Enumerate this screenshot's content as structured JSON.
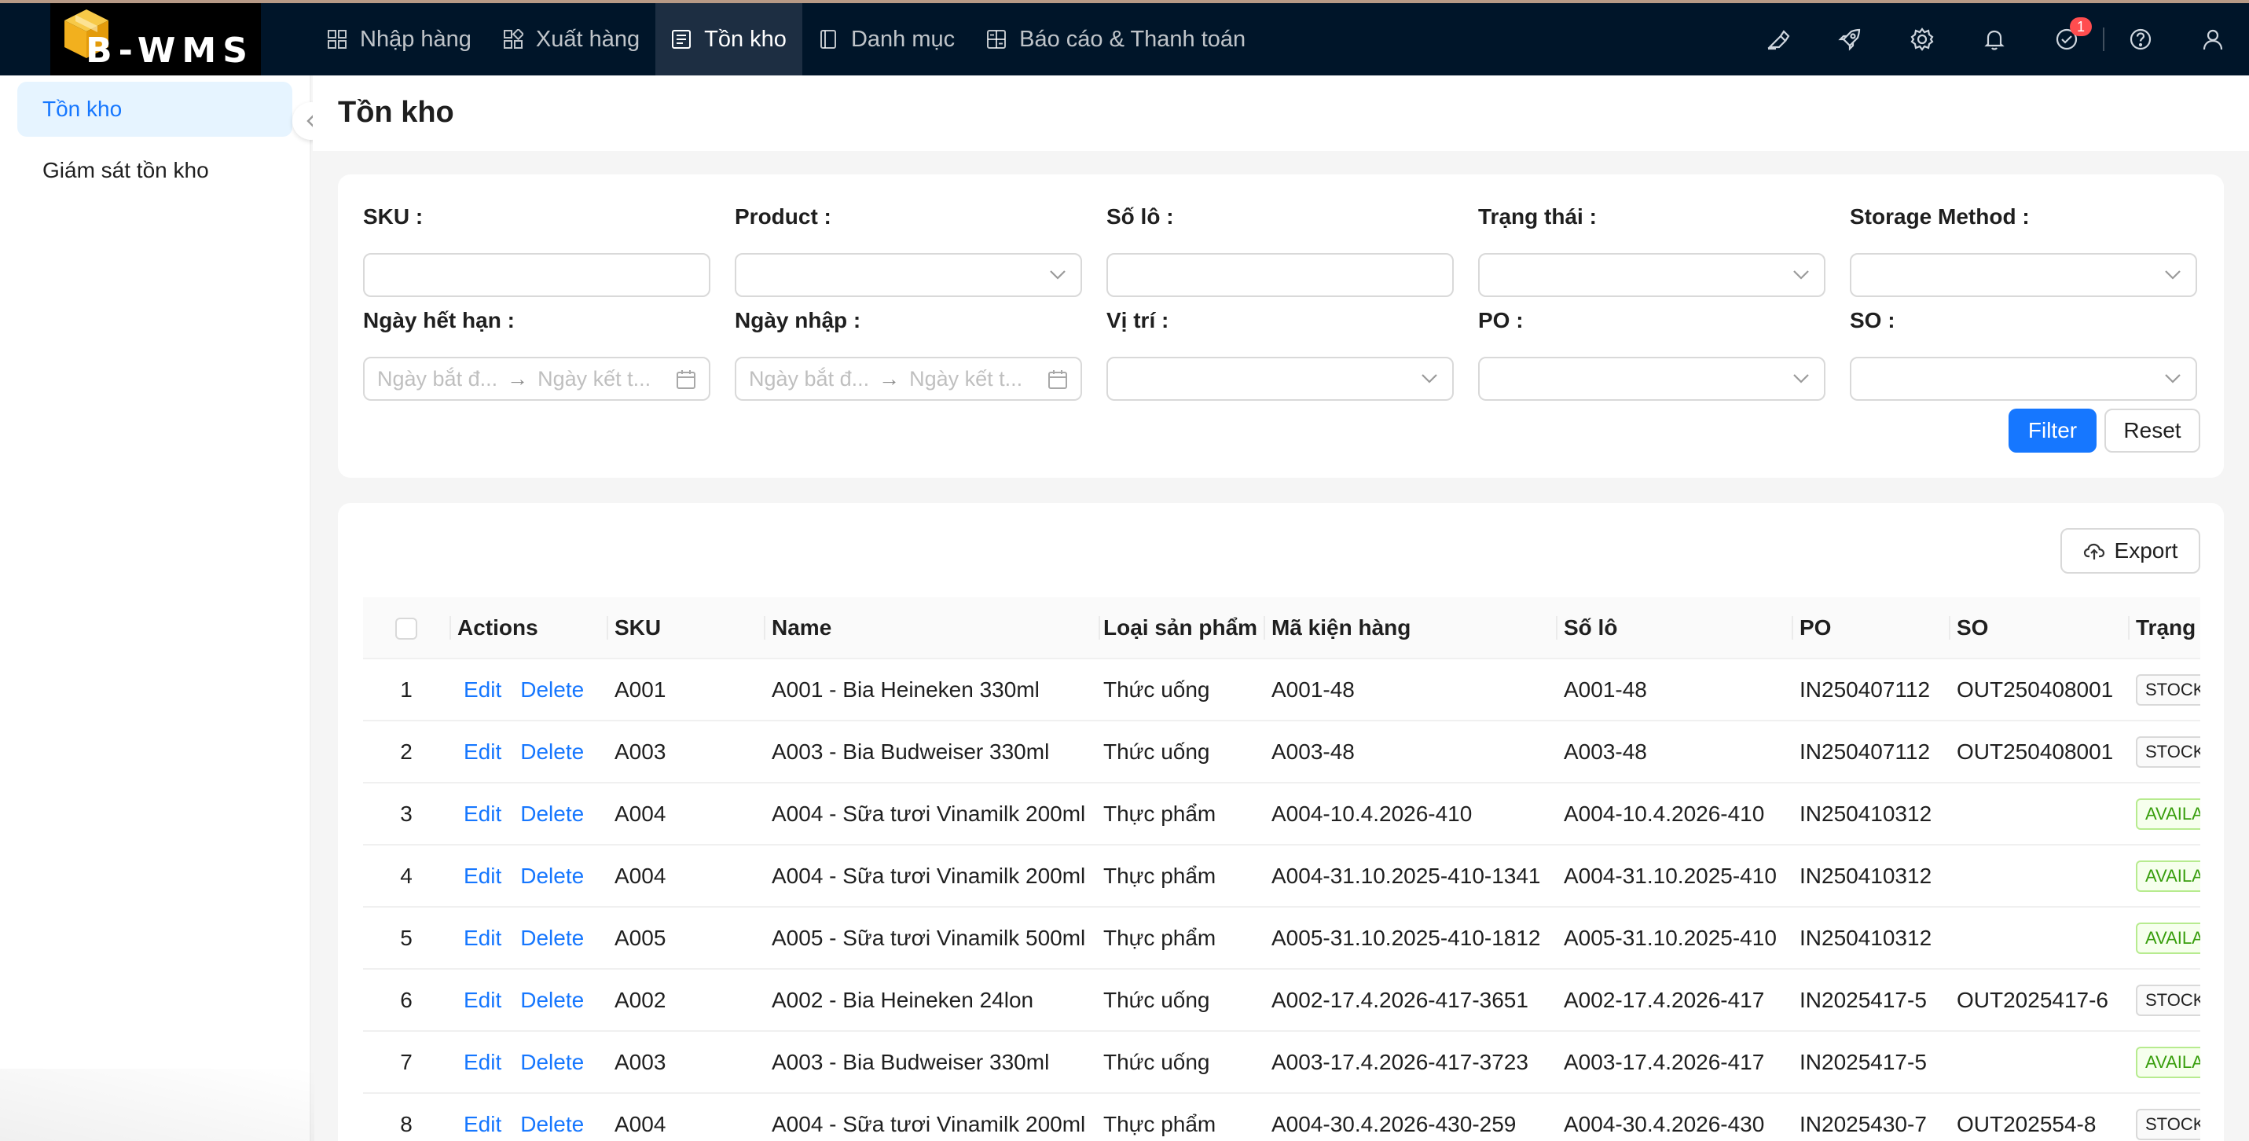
{
  "app": {
    "logo_text": "B-WMS",
    "nav": [
      {
        "label": "Nhập hàng",
        "icon": "grid-icon"
      },
      {
        "label": "Xuất hàng",
        "icon": "apps-icon"
      },
      {
        "label": "Tồn kho",
        "icon": "list-icon",
        "active": true
      },
      {
        "label": "Danh mục",
        "icon": "book-icon"
      },
      {
        "label": "Báo cáo & Thanh toán",
        "icon": "calculator-icon"
      }
    ],
    "notification_badge": "1",
    "accent_color": "#1677ff",
    "header_bg": "#001529"
  },
  "sidebar": {
    "items": [
      {
        "label": "Tồn kho",
        "active": true
      },
      {
        "label": "Giám sát tồn kho"
      }
    ]
  },
  "page": {
    "title": "Tồn kho"
  },
  "filters": {
    "sku_label": "SKU :",
    "product_label": "Product :",
    "lot_label": "Số lô :",
    "status_label": "Trạng thái :",
    "storage_label": "Storage Method :",
    "expiry_label": "Ngày hết hạn :",
    "import_label": "Ngày nhập :",
    "location_label": "Vị trí :",
    "po_label": "PO :",
    "so_label": "SO :",
    "range_start_placeholder": "Ngày bắt đ...",
    "range_end_placeholder": "Ngày kết t...",
    "filter_button": "Filter",
    "reset_button": "Reset"
  },
  "table": {
    "export_button": "Export",
    "columns": [
      "Actions",
      "SKU",
      "Name",
      "Loại sản phẩm",
      "Mã kiện hàng",
      "Số lô",
      "PO",
      "SO",
      "Trạng"
    ],
    "edit_label": "Edit",
    "delete_label": "Delete",
    "rows": [
      {
        "no": "1",
        "sku": "A001",
        "name": "A001 - Bia Heineken 330ml",
        "type": "Thức uống",
        "package": "A001-48",
        "lot": "A001-48",
        "po": "IN250407112",
        "so": "OUT250408001",
        "status": "STOCK",
        "status_kind": "stock"
      },
      {
        "no": "2",
        "sku": "A003",
        "name": "A003 - Bia Budweiser 330ml",
        "type": "Thức uống",
        "package": "A003-48",
        "lot": "A003-48",
        "po": "IN250407112",
        "so": "OUT250408001",
        "status": "STOCK",
        "status_kind": "stock"
      },
      {
        "no": "3",
        "sku": "A004",
        "name": "A004 - Sữa tươi Vinamilk 200ml",
        "type": "Thực phẩm",
        "package": "A004-10.4.2026-410",
        "lot": "A004-10.4.2026-410",
        "po": "IN250410312",
        "so": "",
        "status": "AVAILABLE",
        "status_kind": "available"
      },
      {
        "no": "4",
        "sku": "A004",
        "name": "A004 - Sữa tươi Vinamilk 200ml",
        "type": "Thực phẩm",
        "package": "A004-31.10.2025-410-1341",
        "lot": "A004-31.10.2025-410",
        "po": "IN250410312",
        "so": "",
        "status": "AVAILABLE",
        "status_kind": "available"
      },
      {
        "no": "5",
        "sku": "A005",
        "name": "A005 - Sữa tươi Vinamilk 500ml",
        "type": "Thực phẩm",
        "package": "A005-31.10.2025-410-1812",
        "lot": "A005-31.10.2025-410",
        "po": "IN250410312",
        "so": "",
        "status": "AVAILABLE",
        "status_kind": "available"
      },
      {
        "no": "6",
        "sku": "A002",
        "name": "A002 - Bia Heineken 24lon",
        "type": "Thức uống",
        "package": "A002-17.4.2026-417-3651",
        "lot": "A002-17.4.2026-417",
        "po": "IN2025417-5",
        "so": "OUT2025417-6",
        "status": "STOCK",
        "status_kind": "stock"
      },
      {
        "no": "7",
        "sku": "A003",
        "name": "A003 - Bia Budweiser 330ml",
        "type": "Thức uống",
        "package": "A003-17.4.2026-417-3723",
        "lot": "A003-17.4.2026-417",
        "po": "IN2025417-5",
        "so": "",
        "status": "AVAILABLE",
        "status_kind": "available"
      },
      {
        "no": "8",
        "sku": "A004",
        "name": "A004 - Sữa tươi Vinamilk 200ml",
        "type": "Thực phẩm",
        "package": "A004-30.4.2026-430-259",
        "lot": "A004-30.4.2026-430",
        "po": "IN2025430-7",
        "so": "OUT202554-8",
        "status": "STOCK",
        "status_kind": "stock"
      }
    ]
  }
}
